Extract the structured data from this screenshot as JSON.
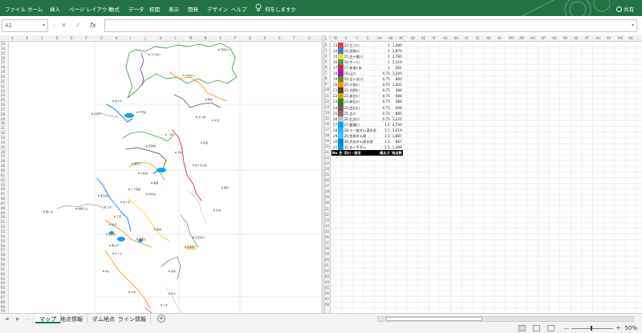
{
  "ribbon": {
    "tabs": [
      "ファイル",
      "ホーム",
      "挿入",
      "ページ レイアウト",
      "数式",
      "データ",
      "校閲",
      "表示",
      "開発",
      "デザイン",
      "ヘルプ"
    ],
    "tell_me": "何をしますか",
    "user": "共有",
    "lightbulb_icon": "lightbulb-icon",
    "share_icon": "person-icon"
  },
  "formula_bar": {
    "name_box": "A1",
    "cancel_glyph": "✕",
    "enter_glyph": "✓",
    "fx_glyph": "fx",
    "formula": ""
  },
  "columns_left": [
    "A",
    "B",
    "C",
    "D",
    "E",
    "F",
    "G",
    "H",
    "I",
    "J",
    "K",
    "L",
    "M",
    "N",
    "O",
    "P",
    "Q",
    "R",
    "S",
    "T",
    "U"
  ],
  "columns_right": [
    "W",
    "X",
    "Y",
    "Z",
    "AA",
    "AB",
    "AC",
    "AD",
    "AE",
    "AF",
    "AG",
    "AH",
    "AI",
    "AJ",
    "AK",
    "AL",
    "AM",
    "AN",
    "AO",
    "AP",
    "AQ",
    "AR",
    "AS",
    "AT",
    "AU",
    "AV",
    "AW",
    "AX"
  ],
  "rows_left": [
    "13",
    "14",
    "15",
    "16",
    "17",
    "18",
    "19",
    "20",
    "21",
    "22",
    "23",
    "24",
    "25",
    "26",
    "27",
    "28",
    "29",
    "30",
    "31",
    "32",
    "33",
    "34",
    "35",
    "36",
    "37",
    "38",
    "39",
    "40",
    "41",
    "42",
    "43",
    "44",
    "45",
    "46",
    "47",
    "48",
    "49",
    "50",
    "51",
    "52",
    "53",
    "54",
    "55",
    "56",
    "57",
    "58",
    "59",
    "60",
    "61",
    "62",
    "63",
    "64",
    "65",
    "66",
    "67",
    "68",
    "69",
    "70"
  ],
  "rows_right": [
    "1",
    "2",
    "3",
    "4",
    "5",
    "6",
    "7",
    "8",
    "9",
    "10",
    "11",
    "12",
    "13",
    "14",
    "15",
    "16",
    "17",
    "18",
    "19",
    "20",
    "21",
    "22",
    "23",
    "24",
    "25",
    "26",
    "27",
    "28",
    "29",
    "30",
    "31",
    "32",
    "33",
    "34",
    "35",
    "36",
    "37",
    "38",
    "39",
    "40",
    "41",
    "42",
    "43",
    "44",
    "45",
    "46",
    "47",
    "48"
  ],
  "legend": {
    "rows": [
      {
        "no": "13",
        "color": "#e53935",
        "name": "13.三ツ川",
        "a": "1",
        "b": "1,489"
      },
      {
        "no": "14",
        "color": "#1e88e5",
        "name": "14.羽鳥川",
        "a": "1",
        "b": "1,870"
      },
      {
        "no": "15",
        "color": "#fdd835",
        "name": "15.五十嵐川",
        "a": "1",
        "b": "2,780"
      },
      {
        "no": "16",
        "color": "#43a047",
        "name": "16.中ノ川",
        "a": "1",
        "b": "1,119"
      },
      {
        "no": "17",
        "color": "#d81b60",
        "name": "17.赤鬼川b",
        "a": "1",
        "b": "281"
      },
      {
        "no": "18",
        "color": "#8e24aa",
        "name": "18.山川",
        "a": "0.75",
        "b": "1,249"
      },
      {
        "no": "19",
        "color": "#6d8a2a",
        "name": "19.吉ヶ岳川",
        "a": "0.75",
        "b": "860"
      },
      {
        "no": "20",
        "color": "#fb8c00",
        "name": "20.小俣川",
        "a": "0.75",
        "b": "1,402"
      },
      {
        "no": "21",
        "color": "#5d4037",
        "name": "21.光明川",
        "a": "0.75",
        "b": "388"
      },
      {
        "no": "22",
        "color": "#c6a700",
        "name": "22.赤谷川",
        "a": "0.75",
        "b": "688"
      },
      {
        "no": "23",
        "color": "#2e7d32",
        "name": "23.赤石川",
        "a": "0.75",
        "b": "388"
      },
      {
        "no": "24",
        "color": "#795548",
        "name": "24.白石川",
        "a": "0.75",
        "b": "508"
      },
      {
        "no": "25",
        "color": "#8d6e63",
        "name": "25.吉川",
        "a": "0.75",
        "b": "885"
      },
      {
        "no": "26",
        "color": "#bdbdbd",
        "name": "26.北沢川",
        "a": "0.75",
        "b": "1,225"
      },
      {
        "no": "27",
        "color": "#03a9f4",
        "name": "27.鹿瀬川",
        "a": "1.5",
        "b": "4,750"
      },
      {
        "no": "28",
        "color": "#29b6f6",
        "name": "28.十一夜ダム湛水池",
        "a": "1.5",
        "b": "3,019"
      },
      {
        "no": "29",
        "color": "#4fc3f7",
        "name": "29.笠堀ダム湖",
        "a": "1.5",
        "b": "1,887"
      },
      {
        "no": "30",
        "color": "#0288d1",
        "name": "30.大谷ダム湛水池",
        "a": "1.5",
        "b": "887"
      },
      {
        "no": "31",
        "color": "#039be5",
        "name": "31.吉ヶ平ダム",
        "a": "1.5",
        "b": "1,308"
      }
    ],
    "header": {
      "no": "No",
      "sw": "色",
      "name": "河川・湖沼",
      "a": "線太さ",
      "b": "地点数"
    }
  },
  "map_labels": [
    "五十嵐川",
    "笠堀ダム",
    "大谷ダム",
    "吉ヶ平",
    "光明川",
    "守門岳",
    "ダム湖",
    "一本杉",
    "笠堀湖",
    "大谷",
    "吉ヶ平山荘",
    "鹿熊川",
    "鹿瀬",
    "八十里越",
    "浅草岳",
    "烏帽子山",
    "粟ヶ岳",
    "三条",
    "下田",
    "長沢",
    "鞍掛峠",
    "栗山沢",
    "番屋山",
    "矢筈岳",
    "中ノ又",
    "烏川",
    "大池",
    "赤川",
    "八木",
    "遅場",
    "北五百川",
    "西五百川",
    "吉ヶ平",
    "大谷地",
    "鹿峠",
    "駒出",
    "北潟",
    "荻堀",
    "高城",
    "濁沢"
  ],
  "sheets": {
    "tabs": [
      "マップ",
      "地点情報",
      "ダム地点",
      "ライン情報"
    ],
    "active": 0,
    "add_glyph": "+",
    "nav_prev": "◀",
    "nav_next": "▶",
    "more": "…"
  },
  "status": {
    "zoom": "50%",
    "zoom_minus": "－",
    "zoom_plus": "+"
  }
}
